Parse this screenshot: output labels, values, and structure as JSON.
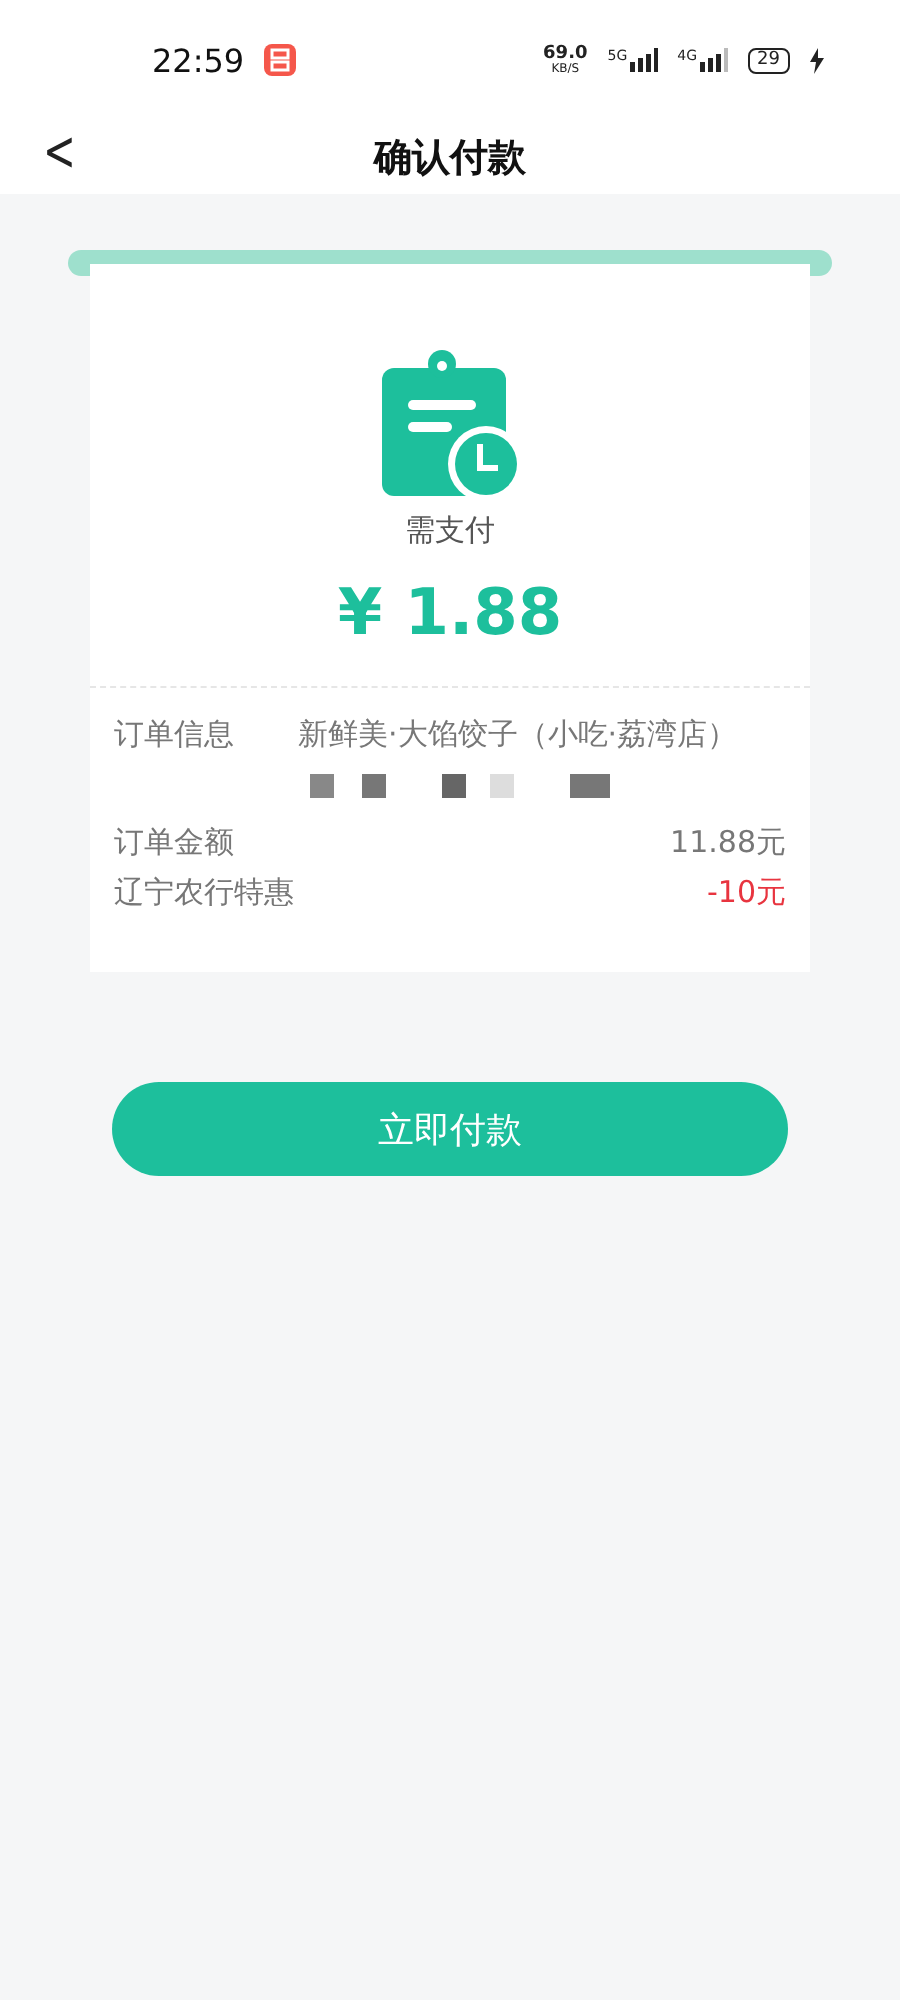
{
  "status_bar": {
    "time": "22:59",
    "speed_value": "69.0",
    "speed_unit": "KB/S",
    "network_1": "5G",
    "network_2": "4G",
    "battery": "29",
    "charging": true
  },
  "header": {
    "back": "<",
    "title": "确认付款"
  },
  "payment": {
    "label": "需支付",
    "amount": "¥ 1.88"
  },
  "order": {
    "rows": [
      {
        "label": "订单信息",
        "value": "新鲜美·大馅饺子（小吃·荔湾店）",
        "redacted": true,
        "kind": "info"
      },
      {
        "label": "订单金额",
        "value": "11.88元",
        "kind": "amount"
      },
      {
        "label": "辽宁农行特惠",
        "value": "-10元",
        "kind": "discount"
      }
    ]
  },
  "pay_button": {
    "label": "立即付款"
  }
}
